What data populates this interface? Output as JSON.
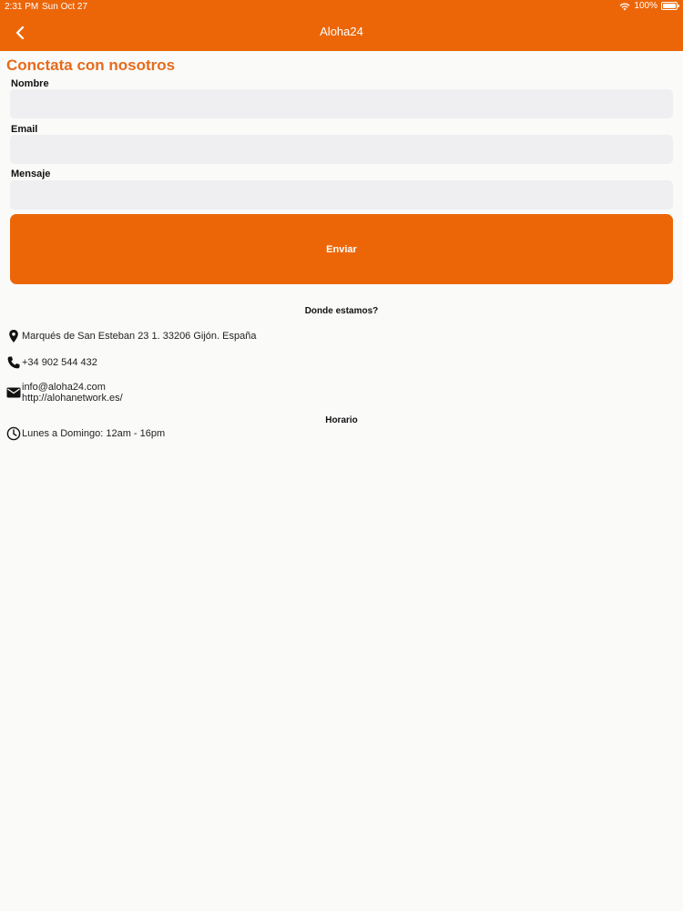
{
  "status_bar": {
    "time": "2:31 PM",
    "date": "Sun Oct 27",
    "battery": "100%"
  },
  "nav": {
    "title": "Aloha24",
    "back_icon": "chevron-left-icon"
  },
  "form": {
    "title": "Conctata con nosotros",
    "name_label": "Nombre",
    "name_value": "",
    "email_label": "Email",
    "email_value": "",
    "message_label": "Mensaje",
    "message_value": "",
    "submit_label": "Enviar"
  },
  "location": {
    "heading": "Donde estamos?",
    "address": "Marqués de San Esteban 23 1. 33206 Gijón. España",
    "phone": "+34 902 544 432",
    "email": "info@aloha24.com",
    "website": "http://alohanetwork.es/"
  },
  "schedule": {
    "heading": "Horario",
    "hours": "Lunes a Domingo: 12am - 16pm"
  },
  "colors": {
    "accent": "#ec6608",
    "title": "#e76b1b",
    "input_bg": "#efeff1",
    "page_bg": "#fafaf9"
  }
}
